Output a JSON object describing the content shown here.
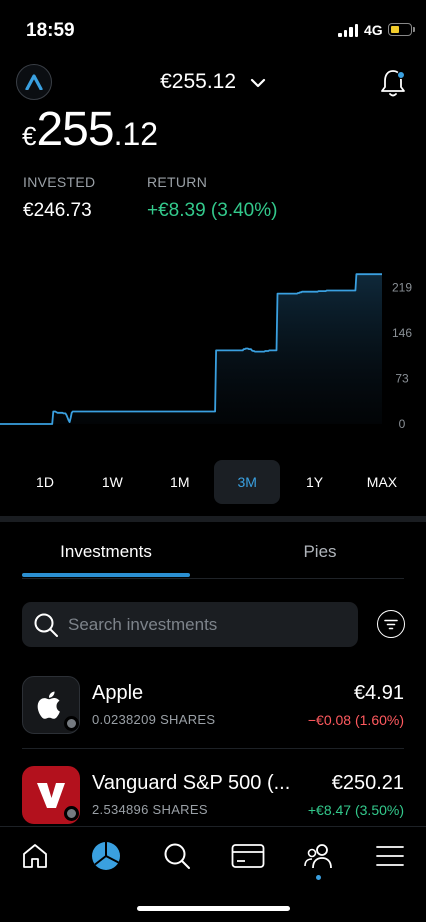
{
  "status": {
    "time": "18:59",
    "network": "4G"
  },
  "header": {
    "total": "€255.12"
  },
  "portfolio": {
    "currency": "€",
    "value_int": "255",
    "value_dec": ".12",
    "invested_label": "INVESTED",
    "invested_value": "€246.73",
    "return_label": "RETURN",
    "return_value": "+€8.39 (3.40%)"
  },
  "chart_data": {
    "type": "line",
    "y_ticks": [
      "219",
      "146",
      "73",
      "0"
    ],
    "ylim": [
      0,
      250
    ],
    "line_color": "#3aa0e0",
    "values": [
      0,
      0,
      0,
      0,
      0,
      0,
      0,
      0,
      0,
      0,
      0,
      0,
      0,
      0,
      0,
      0,
      0,
      0,
      0,
      0,
      0,
      0,
      0,
      0,
      0,
      0,
      0,
      0,
      0,
      0,
      0,
      0,
      0,
      0,
      0,
      0,
      0,
      0,
      0,
      0,
      0,
      0,
      0,
      0,
      0,
      0,
      0,
      0,
      0,
      0,
      0,
      0,
      20,
      20,
      20,
      19,
      18,
      18,
      18,
      18,
      18,
      18,
      17,
      17,
      17,
      14,
      10,
      6,
      3,
      10,
      18,
      20,
      20,
      20,
      20,
      20,
      20,
      20,
      20,
      20,
      20,
      20,
      20,
      20,
      20,
      20,
      20,
      20,
      20,
      20,
      20,
      20,
      20,
      20,
      20,
      20,
      20,
      20,
      20,
      20,
      20,
      20,
      20,
      20,
      20,
      20,
      20,
      20,
      20,
      20,
      20,
      20,
      20,
      20,
      20,
      20,
      20,
      20,
      20,
      20,
      20,
      20,
      20,
      20,
      20,
      20,
      20,
      20,
      20,
      20,
      20,
      20,
      20,
      20,
      20,
      20,
      20,
      20,
      20,
      20,
      20,
      20,
      20,
      20,
      20,
      20,
      20,
      20,
      20,
      20,
      20,
      20,
      20,
      20,
      20,
      20,
      20,
      20,
      20,
      20,
      20,
      20,
      20,
      20,
      20,
      20,
      20,
      20,
      20,
      20,
      20,
      20,
      20,
      20,
      20,
      20,
      20,
      20,
      20,
      20,
      20,
      20,
      20,
      20,
      20,
      20,
      20,
      20,
      20,
      20,
      20,
      20,
      20,
      20,
      20,
      20,
      20,
      20,
      20,
      20,
      20,
      20,
      20,
      20,
      20,
      20,
      20,
      20,
      20,
      20,
      20,
      118,
      118,
      118,
      118,
      118,
      118,
      118,
      118,
      118,
      118,
      118,
      118,
      118,
      118,
      118,
      118,
      118,
      118,
      118,
      118,
      118,
      118,
      118,
      118,
      118,
      118,
      118,
      120,
      120,
      121,
      121,
      121,
      120,
      120,
      120,
      118,
      117,
      117,
      116,
      116,
      116,
      116,
      116,
      116,
      116,
      116,
      116,
      116,
      117,
      117,
      117,
      117,
      118,
      118,
      118,
      118,
      118,
      118,
      118,
      118,
      209,
      209,
      209,
      209,
      209,
      209,
      209,
      209,
      209,
      209,
      209,
      209,
      209,
      209,
      209,
      209,
      209,
      209,
      209,
      209,
      210,
      210,
      211,
      211,
      212,
      212,
      212,
      212,
      212,
      212,
      212,
      212,
      212,
      212,
      212,
      212,
      212,
      212,
      212,
      212,
      213,
      213,
      213,
      213,
      213,
      213,
      213,
      213,
      214,
      214,
      214,
      214,
      214,
      214,
      214,
      214,
      214,
      214,
      214,
      214,
      214,
      214,
      214,
      214,
      214,
      214,
      214,
      214,
      214,
      214,
      214,
      214,
      214,
      214,
      214,
      214,
      214,
      240,
      240,
      240,
      240,
      240,
      240,
      240,
      240,
      240,
      240,
      240,
      240,
      240,
      240,
      240,
      240,
      240,
      240,
      240,
      240,
      240,
      240,
      240,
      240,
      240,
      240
    ]
  },
  "ranges": [
    {
      "label": "1D",
      "active": false
    },
    {
      "label": "1W",
      "active": false
    },
    {
      "label": "1M",
      "active": false
    },
    {
      "label": "3M",
      "active": true
    },
    {
      "label": "1Y",
      "active": false
    },
    {
      "label": "MAX",
      "active": false
    }
  ],
  "tabs": {
    "investments": "Investments",
    "pies": "Pies"
  },
  "search": {
    "placeholder": "Search investments"
  },
  "holdings": [
    {
      "name": "Apple",
      "shares": "0.0238209 SHARES",
      "value": "€4.91",
      "change": "−€0.08 (1.60%)",
      "change_color": "#ff5a5f"
    },
    {
      "name": "Vanguard S&P 500 (...",
      "shares": "2.534896 SHARES",
      "value": "€250.21",
      "change": "+€8.47 (3.50%)",
      "change_color": "#33c98c"
    }
  ],
  "colors": {
    "accent": "#3aa0e0",
    "positive": "#33c98c",
    "negative": "#ff5a5f",
    "background": "#000000"
  }
}
